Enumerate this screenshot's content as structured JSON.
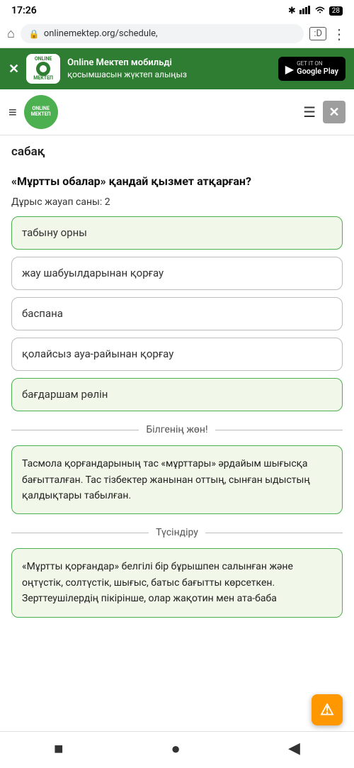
{
  "statusBar": {
    "time": "17:26",
    "bluetooth": "✱",
    "signal": "📶",
    "wifi": "WiFi",
    "battery": "28"
  },
  "browserBar": {
    "url": "onlinemektep.org/schedule,",
    "tabLabel": ":D"
  },
  "greenBanner": {
    "logoTopLine": "ONLINE",
    "logoBottomLine": "МЕКТЕП",
    "mainText": "Online Мектеп мобильді",
    "subText": "қосымшасын жүктеп алыңыз",
    "googlePlayLabel": "GET IT ON",
    "googlePlayName": "Google Play"
  },
  "appHeader": {
    "logoLine1": "ONLINE",
    "logoLine2": "МЕКТЕП"
  },
  "content": {
    "lessonTitle": "сабақ",
    "questionTitle": "«Мұртты обалар» қандай қызмет атқарған?",
    "correctCount": "Дұрыс жауап саны: 2",
    "answers": [
      {
        "text": "табыну орны",
        "selected": true
      },
      {
        "text": "жау шабуылдарынан қорғау",
        "selected": false
      },
      {
        "text": "баспана",
        "selected": false
      },
      {
        "text": "қолайсыз ауа-райынан қорғау",
        "selected": false
      },
      {
        "text": "бағдаршам рөлін",
        "selected": true
      }
    ],
    "bilgeniLabel": "Білгенің жөн!",
    "infoText": "Тасмола қорғандарының тас «мұрттары» әрдайым шығысқа бағытталған. Тас тізбектер жанынан оттың, сынған ыдыстың қалдықтары табылған.",
    "tusindiru": "Түсіндіру",
    "explainText": "«Мұртты қорғандар» белгілі бір бұрышпен салынған және оңтүстік, солтүстік, шығыс, батыс бағытты көрсеткен. Зерттеушілердің пікірінше, олар жақотин мен ата-баба"
  }
}
